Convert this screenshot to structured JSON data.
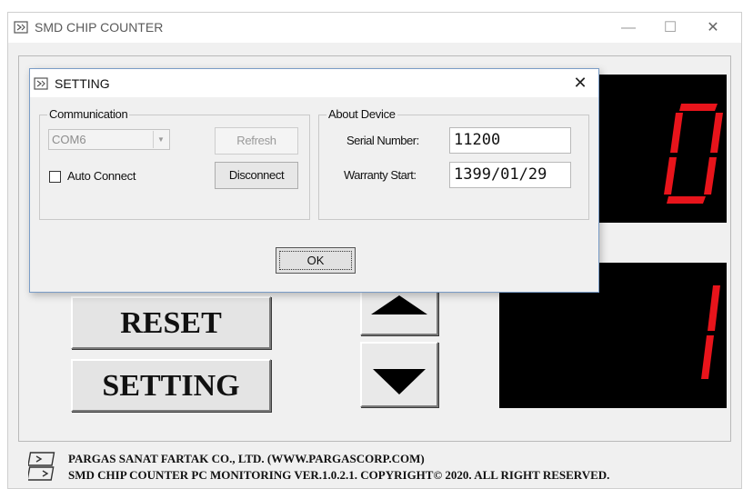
{
  "main_window": {
    "title": "SMD CHIP COUNTER",
    "caption_buttons": {
      "minimize": "—",
      "maximize": "☐",
      "close": "✕"
    },
    "buttons": {
      "reset": "RESET",
      "setting": "SETTING"
    },
    "arrows": {
      "up_icon": "triangle-up-icon",
      "down_icon": "triangle-down-icon"
    },
    "displays": {
      "top_digit": "0",
      "bottom_digit": "1",
      "segment_color": "#e8141b"
    },
    "footer": {
      "line_1": "PARGAS SANAT FARTAK CO., LTD. (WWW.PARGASCORP.COM)",
      "line_2": "SMD CHIP COUNTER PC MONITORING VER.1.0.2.1. COPYRIGHT© 2020. ALL RIGHT RESERVED."
    }
  },
  "dialog": {
    "title": "SETTING",
    "close": "✕",
    "communication": {
      "label": "Communication",
      "port": "COM6",
      "refresh": "Refresh",
      "disconnect": "Disconnect",
      "auto_connect_label": "Auto Connect",
      "auto_connect_checked": false
    },
    "about": {
      "label": "About Device",
      "serial_label": "Serial Number:",
      "serial_value": "11200",
      "warranty_label": "Warranty Start:",
      "warranty_value": "1399/01/29"
    },
    "ok": "OK"
  }
}
